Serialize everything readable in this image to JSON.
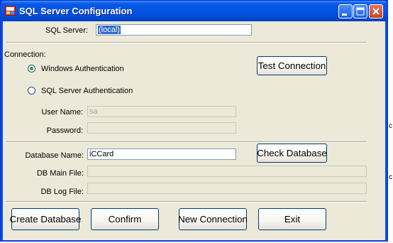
{
  "window": {
    "title": "SQL Server Configuration",
    "buttons": {
      "minimize": "minimize",
      "maximize": "maximize",
      "close": "close"
    }
  },
  "server": {
    "label": "SQL Server:",
    "value": "(local)"
  },
  "connection": {
    "section_label": "Connection:",
    "windows_auth_label": "Windows Authentication",
    "sql_auth_label": "SQL Server Authentication",
    "selected": "windows",
    "user_name_label": "User Name:",
    "user_name_value": "sa",
    "password_label": "Password:",
    "password_value": "",
    "test_button": "Test Connection"
  },
  "database": {
    "name_label": "Database Name:",
    "name_value": "iCCard",
    "check_button": "Check Database",
    "main_file_label": "DB Main File:",
    "main_file_value": "",
    "log_file_label": "DB Log File:",
    "log_file_value": ""
  },
  "actions": {
    "create": "Create Database",
    "confirm": "Confirm",
    "new_connection": "New Connection",
    "exit": "Exit"
  },
  "background_fragments": {
    "right_1": "c",
    "right_2": "c"
  },
  "colors": {
    "titlebar": "#0153e3",
    "face": "#ece9d8",
    "selection": "#316ac5"
  }
}
